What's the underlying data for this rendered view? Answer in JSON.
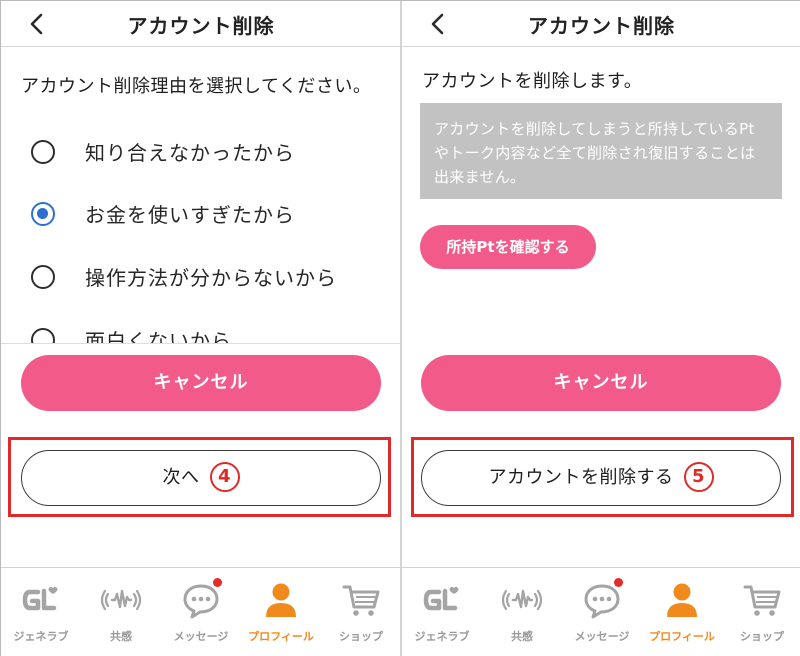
{
  "left": {
    "header": {
      "title": "アカウント削除"
    },
    "prompt": "アカウント削除理由を選択してください。",
    "reasons": [
      {
        "label": "知り合えなかったから",
        "selected": false
      },
      {
        "label": "お金を使いすぎたから",
        "selected": true
      },
      {
        "label": "操作方法が分からないから",
        "selected": false
      },
      {
        "label": "面白くないから",
        "selected": false
      }
    ],
    "cancel_label": "キャンセル",
    "next_label": "次へ",
    "step": "4"
  },
  "right": {
    "header": {
      "title": "アカウント削除"
    },
    "notice_title": "アカウントを削除します。",
    "notice_text": "アカウントを削除してしまうと所持しているPtやトーク内容など全て削除され復旧することは出来ません。",
    "check_points_label": "所持Ptを確認する",
    "cancel_label": "キャンセル",
    "delete_label": "アカウントを削除する",
    "step": "5"
  },
  "tabs": [
    {
      "label": "ジェネラブ",
      "icon": "gl-logo-icon",
      "active": false
    },
    {
      "label": "共感",
      "icon": "soundwave-icon",
      "active": false
    },
    {
      "label": "メッセージ",
      "icon": "chat-bubble-icon",
      "active": false,
      "badge": true
    },
    {
      "label": "プロフィール",
      "icon": "person-icon",
      "active": true
    },
    {
      "label": "ショップ",
      "icon": "cart-icon",
      "active": false
    }
  ],
  "colors": {
    "accent_pink": "#f25a8a",
    "highlight_red": "#e02a2a",
    "radio_blue": "#2d6fd1",
    "tab_active_orange": "#f08a1d",
    "tab_inactive_gray": "#9a9a9a",
    "notice_box_gray": "#c2c2c2"
  }
}
